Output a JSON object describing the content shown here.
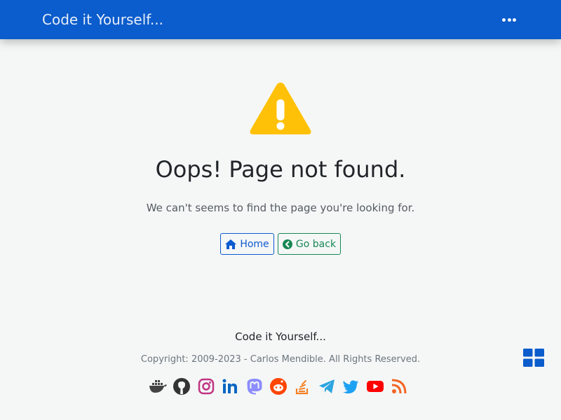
{
  "navbar": {
    "brand": "Code it Yourself...",
    "more_icon": "ellipsis-icon"
  },
  "error": {
    "icon": "warning-triangle-icon",
    "title": "Oops! Page not found.",
    "message": "We can't seems to find the page you're looking for."
  },
  "buttons": {
    "home_label": "Home",
    "home_icon": "home-icon",
    "back_label": "Go back",
    "back_icon": "chevron-circle-left-icon"
  },
  "footer": {
    "brand": "Code it Yourself...",
    "copyright": "Copyright: 2009-2023 - Carlos Mendible. All Rights Reserved.",
    "social_icons": [
      "docker-icon",
      "github-icon",
      "instagram-icon",
      "linkedin-icon",
      "mastodon-icon",
      "reddit-icon",
      "stackoverflow-icon",
      "telegram-icon",
      "twitter-icon",
      "youtube-icon",
      "rss-icon"
    ]
  },
  "floating": {
    "icon": "grid-icon"
  },
  "colors": {
    "navbar": "#0b5ccc",
    "warning": "#ffc107",
    "primary": "#0d5bd0",
    "success": "#198754",
    "background": "#f5f7f7"
  }
}
